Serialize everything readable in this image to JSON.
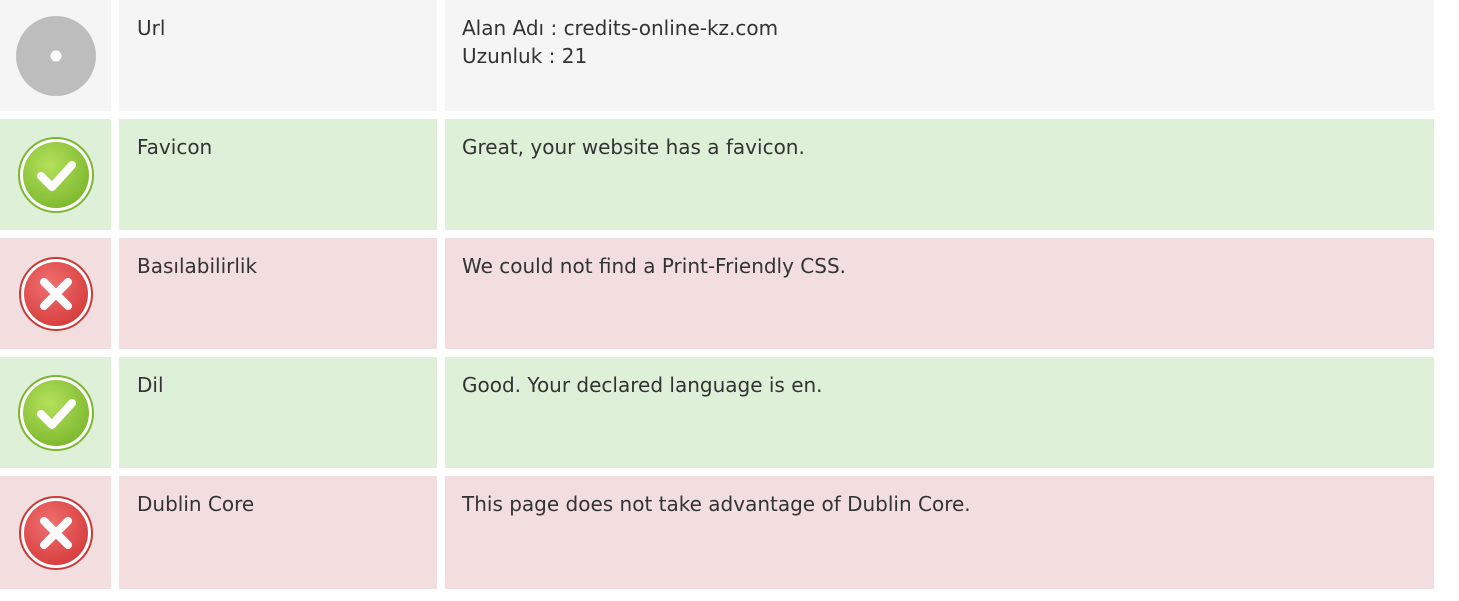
{
  "rows": [
    {
      "status": "neutral",
      "icon": "neutral-circle-icon",
      "label": "Url",
      "lines": [
        "Alan Adı : credits-online-kz.com",
        "Uzunluk : 21"
      ]
    },
    {
      "status": "success",
      "icon": "check-circle-icon",
      "label": "Favicon",
      "lines": [
        "Great, your website has a favicon."
      ]
    },
    {
      "status": "error",
      "icon": "error-x-circle-icon",
      "label": "Basılabilirlik",
      "lines": [
        "We could not find a Print-Friendly CSS."
      ]
    },
    {
      "status": "success",
      "icon": "check-circle-icon",
      "label": "Dil",
      "lines": [
        "Good. Your declared language is en."
      ]
    },
    {
      "status": "error",
      "icon": "error-x-circle-icon",
      "label": "Dublin Core",
      "lines": [
        "This page does not take advantage of Dublin Core."
      ]
    }
  ],
  "colors": {
    "neutral_bg": "#f5f5f5",
    "success_bg": "#dff0d8",
    "error_bg": "#f2dede",
    "success_icon": "#8cc63f",
    "error_icon": "#e04a4a",
    "neutral_icon": "#bdbdbd"
  }
}
